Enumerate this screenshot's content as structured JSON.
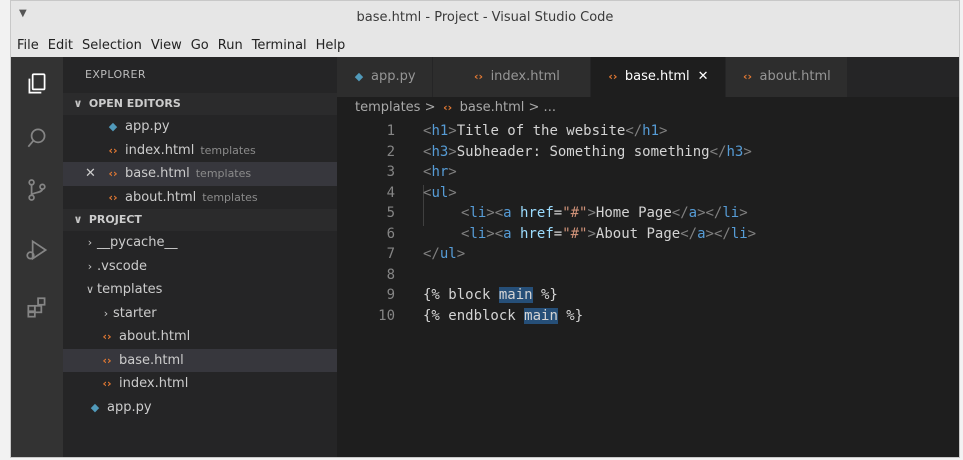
{
  "window": {
    "title": "base.html - Project - Visual Studio Code"
  },
  "menu": [
    "File",
    "Edit",
    "Selection",
    "View",
    "Go",
    "Run",
    "Terminal",
    "Help"
  ],
  "sidebar": {
    "title": "EXPLORER",
    "open_editors": {
      "label": "OPEN EDITORS",
      "items": [
        {
          "name": "app.py",
          "hint": ""
        },
        {
          "name": "index.html",
          "hint": "templates"
        },
        {
          "name": "base.html",
          "hint": "templates",
          "close": "✕"
        },
        {
          "name": "about.html",
          "hint": "templates"
        }
      ]
    },
    "project": {
      "label": "PROJECT",
      "items": [
        {
          "name": "__pycache__"
        },
        {
          "name": ".vscode"
        },
        {
          "name": "templates"
        },
        {
          "name": "starter"
        },
        {
          "name": "about.html"
        },
        {
          "name": "base.html"
        },
        {
          "name": "index.html"
        },
        {
          "name": "app.py"
        }
      ]
    }
  },
  "tabs": [
    {
      "label": "app.py"
    },
    {
      "label": "index.html"
    },
    {
      "label": "base.html",
      "close": "✕"
    },
    {
      "label": "about.html"
    }
  ],
  "breadcrumb": {
    "folder": "templates",
    "sep": ">",
    "file": "base.html",
    "more": "> ..."
  },
  "code": {
    "line_numbers": [
      "1",
      "2",
      "3",
      "4",
      "5",
      "6",
      "7",
      "8",
      "9",
      "10"
    ],
    "l1": {
      "o1": "<",
      "t1": "h1",
      "c1": ">",
      "text": "Title of the website",
      "o2": "</",
      "t2": "h1",
      "c2": ">"
    },
    "l2": {
      "o1": "<",
      "t1": "h3",
      "c1": ">",
      "text": "Subheader: Something something",
      "o2": "</",
      "t2": "h3",
      "c2": ">"
    },
    "l3": {
      "o1": "<",
      "t1": "hr",
      "c1": ">"
    },
    "l4": {
      "o1": "<",
      "t1": "ul",
      "c1": ">"
    },
    "l5": {
      "a": "<",
      "li": "li",
      "b": "><",
      "aa": "a",
      "sp": " ",
      "href": "href",
      "eq": "=",
      "val": "\"#\"",
      "c": ">",
      "text": "Home Page",
      "o2": "</",
      "ta": "a",
      "m": "></",
      "tli": "li",
      "e": ">"
    },
    "l6": {
      "a": "<",
      "li": "li",
      "b": "><",
      "aa": "a",
      "sp": " ",
      "href": "href",
      "eq": "=",
      "val": "\"#\"",
      "c": ">",
      "text": "About Page",
      "o2": "</",
      "ta": "a",
      "m": "></",
      "tli": "li",
      "e": ">"
    },
    "l7": {
      "o1": "</",
      "t1": "ul",
      "c1": ">"
    },
    "l9": {
      "pre": "{% block ",
      "hl": "main",
      "post": " %}"
    },
    "l10": {
      "pre": "{% endblock ",
      "hl": "main",
      "post": " %}"
    }
  }
}
